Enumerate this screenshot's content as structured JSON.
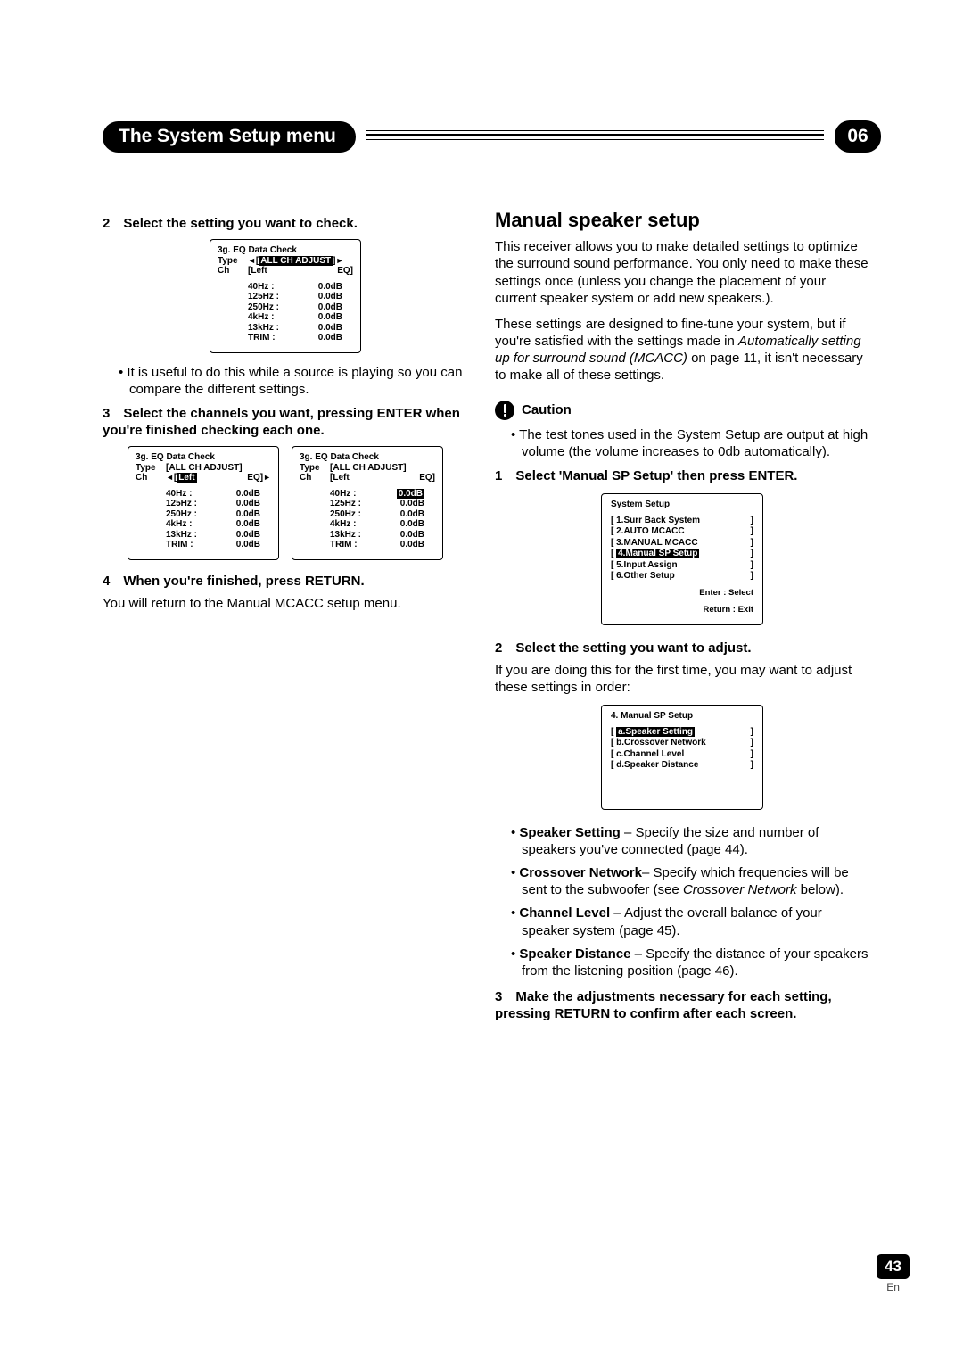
{
  "header": {
    "title": "The System Setup menu",
    "chapter": "06"
  },
  "left": {
    "step2": "2 Select the setting you want to check.",
    "osd1": {
      "title": "3g. EQ Data Check",
      "type_label": "Type",
      "type_value": "ALL CH ADJUST",
      "type_selected": true,
      "ch_label": "Ch",
      "ch_value": "Left",
      "ch_selected": false,
      "eq_label": "EQ",
      "rows": [
        {
          "hz": "40Hz :",
          "db": "0.0dB"
        },
        {
          "hz": "125Hz :",
          "db": "0.0dB"
        },
        {
          "hz": "250Hz :",
          "db": "0.0dB"
        },
        {
          "hz": "4kHz :",
          "db": "0.0dB"
        },
        {
          "hz": "13kHz :",
          "db": "0.0dB"
        },
        {
          "hz": "TRIM :",
          "db": "0.0dB"
        }
      ]
    },
    "bullet1": "It is useful to do this while a source is playing so you can compare the different settings.",
    "step3": "3 Select the channels you want, pressing ENTER when you're finished checking each one.",
    "osd2a": {
      "title": "3g. EQ Data Check",
      "type_label": "Type",
      "type_value": "ALL CH ADJUST",
      "type_selected": false,
      "ch_label": "Ch",
      "ch_value": "Left",
      "ch_selected": true,
      "eq_label": "EQ",
      "rows": [
        {
          "hz": "40Hz :",
          "db": "0.0dB"
        },
        {
          "hz": "125Hz :",
          "db": "0.0dB"
        },
        {
          "hz": "250Hz :",
          "db": "0.0dB"
        },
        {
          "hz": "4kHz :",
          "db": "0.0dB"
        },
        {
          "hz": "13kHz :",
          "db": "0.0dB"
        },
        {
          "hz": "TRIM :",
          "db": "0.0dB"
        }
      ]
    },
    "osd2b": {
      "title": "3g. EQ Data Check",
      "type_label": "Type",
      "type_value": "ALL CH ADJUST",
      "type_selected": false,
      "ch_label": "Ch",
      "ch_value": "Left",
      "ch_selected": false,
      "eq_label": "EQ",
      "highlight_first_db": true,
      "rows": [
        {
          "hz": "40Hz :",
          "db": "0.0dB"
        },
        {
          "hz": "125Hz :",
          "db": "0.0dB"
        },
        {
          "hz": "250Hz :",
          "db": "0.0dB"
        },
        {
          "hz": "4kHz :",
          "db": "0.0dB"
        },
        {
          "hz": "13kHz :",
          "db": "0.0dB"
        },
        {
          "hz": "TRIM :",
          "db": "0.0dB"
        }
      ]
    },
    "step4": "4 When you're finished, press RETURN.",
    "step4_body": "You will return to the Manual MCACC setup menu."
  },
  "right": {
    "h2": "Manual speaker setup",
    "p1": "This receiver allows you to make detailed settings to optimize the surround sound performance. You only need to make these settings once (unless you change the placement of your current speaker system or add new speakers.).",
    "p2_a": "These settings are designed to fine-tune your system, but if you're satisfied with the settings made in ",
    "p2_i": "Automatically setting up for surround sound (MCACC)",
    "p2_b": " on page 11, it isn't necessary to make all of these settings.",
    "caution_label": "Caution",
    "caution_bullet": "The test tones used in the System Setup are output at high volume (the volume increases to 0db automatically).",
    "step1": "1 Select 'Manual SP Setup' then press ENTER.",
    "osd_sys": {
      "title": "System Setup",
      "items": [
        "1.Surr Back System",
        "2.AUTO MCACC",
        "3.MANUAL MCACC",
        "4.Manual SP Setup",
        "5.Input Assign",
        "6.Other Setup"
      ],
      "selected_index": 3,
      "hint1": "Enter  : Select",
      "hint2": "Return : Exit"
    },
    "step2": "2 Select the setting you want to adjust.",
    "step2_body": "If you are doing this for the first time, you may want to adjust these settings in order:",
    "osd_sp": {
      "title": "4. Manual SP Setup",
      "items": [
        "a.Speaker Setting",
        "b.Crossover Network",
        "c.Channel Level",
        "d.Speaker Distance"
      ],
      "selected_index": 0
    },
    "bullets": [
      {
        "bold": "Speaker Setting",
        "rest": " – Specify the size and number of speakers you've connected (page 44)."
      },
      {
        "bold": "Crossover Network",
        "rest": "– Specify which frequencies will be sent to the subwoofer (see ",
        "italic": "Crossover Network",
        "rest2": " below)."
      },
      {
        "bold": "Channel Level",
        "rest": " – Adjust the overall balance of your speaker system (page 45)."
      },
      {
        "bold": "Speaker Distance",
        "rest": " – Specify the distance of your speakers from the listening position (page 46)."
      }
    ],
    "step3": "3 Make the adjustments necessary for each setting, pressing RETURN to confirm after each screen."
  },
  "footer": {
    "page": "43",
    "lang": "En"
  }
}
